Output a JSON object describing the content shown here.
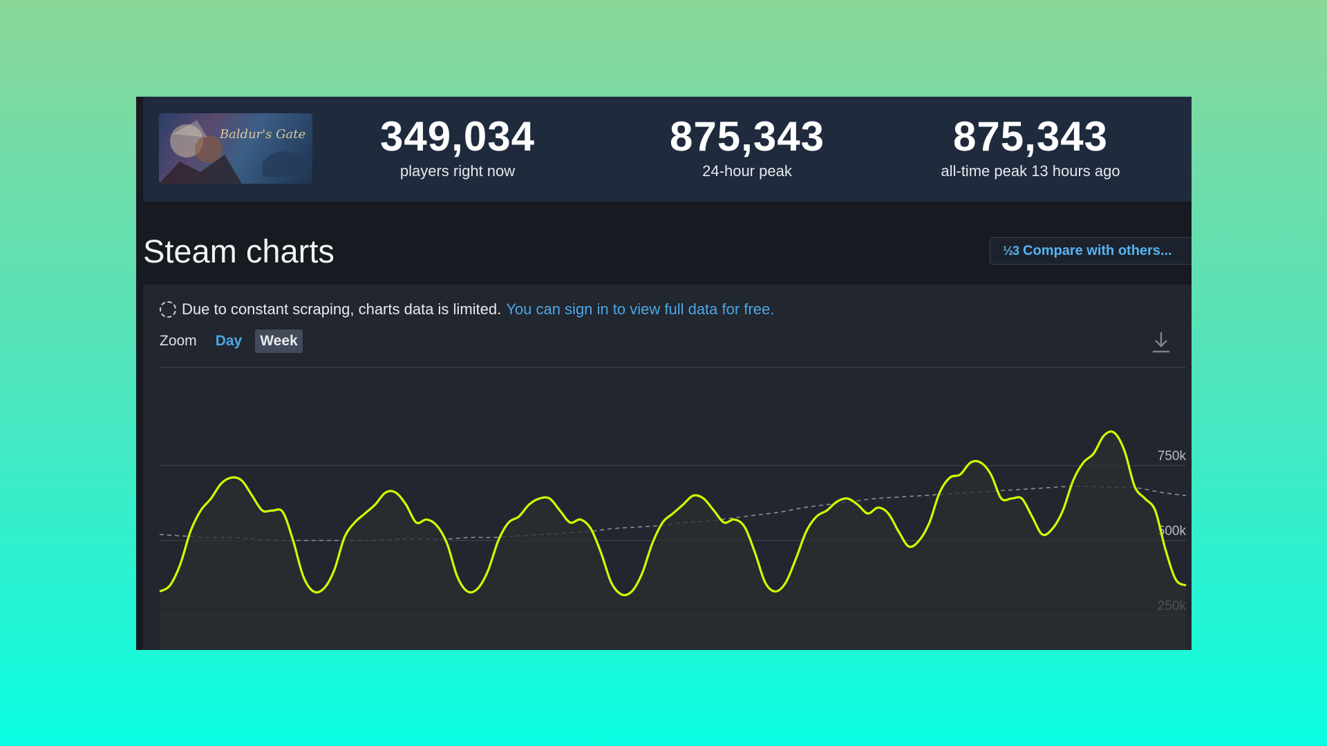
{
  "stats": {
    "players_now": "349,034",
    "players_now_label": "players right now",
    "peak_24h": "875,343",
    "peak_24h_label": "24-hour peak",
    "all_time_peak": "875,343",
    "all_time_peak_label": "all-time peak 13 hours ago"
  },
  "game": {
    "thumbnail_text": "Baldur's Gate"
  },
  "section": {
    "title": "Steam charts",
    "compare_icon": "1/2/3",
    "compare_label": "Compare with others..."
  },
  "notice": {
    "icon": "loading-spinner-icon",
    "text": "Due to constant scraping, charts data is limited.",
    "link": "You can sign in to view full data for free."
  },
  "zoom": {
    "label": "Zoom",
    "options": [
      "Day",
      "Week"
    ],
    "selected": "Week"
  },
  "colors": {
    "line": "#d4ff00",
    "average": "#8a8f98",
    "link": "#4aa8e6",
    "panel": "#171a21",
    "header": "#1f2a3d"
  },
  "chart_data": {
    "type": "line",
    "ylim": [
      0,
      1000000
    ],
    "yticks": [
      250000,
      500000,
      750000
    ],
    "ytick_labels": [
      "250k",
      "500k",
      "750k"
    ],
    "grid": true,
    "series": [
      {
        "values": [
          330000,
          350000,
          420000,
          530000,
          600000,
          640000,
          690000,
          710000,
          700000,
          650000,
          600000,
          600000,
          595000,
          500000,
          380000,
          330000,
          340000,
          400000,
          510000,
          560000,
          590000,
          620000,
          660000,
          660000,
          620000,
          560000,
          570000,
          550000,
          490000,
          380000,
          330000,
          340000,
          400000,
          500000,
          560000,
          580000,
          620000,
          640000,
          640000,
          600000,
          560000,
          570000,
          540000,
          460000,
          360000,
          320000,
          330000,
          390000,
          490000,
          560000,
          590000,
          620000,
          650000,
          640000,
          600000,
          560000,
          570000,
          545000,
          460000,
          360000,
          330000,
          360000,
          440000,
          530000,
          580000,
          600000,
          630000,
          640000,
          620000,
          590000,
          610000,
          590000,
          530000,
          480000,
          500000,
          560000,
          660000,
          710000,
          720000,
          760000,
          760000,
          720000,
          640000,
          640000,
          640000,
          580000,
          520000,
          540000,
          600000,
          700000,
          760000,
          790000,
          850000,
          860000,
          800000,
          680000,
          640000,
          600000,
          470000,
          370000,
          350000
        ]
      },
      {
        "values": [
          520000,
          515000,
          510000,
          510000,
          505000,
          500000,
          500000,
          500000,
          500000,
          500000,
          505000,
          505000,
          505000,
          510000,
          510000,
          515000,
          520000,
          525000,
          530000,
          540000,
          545000,
          550000,
          560000,
          565000,
          575000,
          585000,
          595000,
          610000,
          620000,
          630000,
          640000,
          645000,
          650000,
          655000,
          660000,
          665000,
          670000,
          675000,
          680000,
          680000,
          678000,
          675000,
          660000,
          650000
        ]
      }
    ]
  }
}
